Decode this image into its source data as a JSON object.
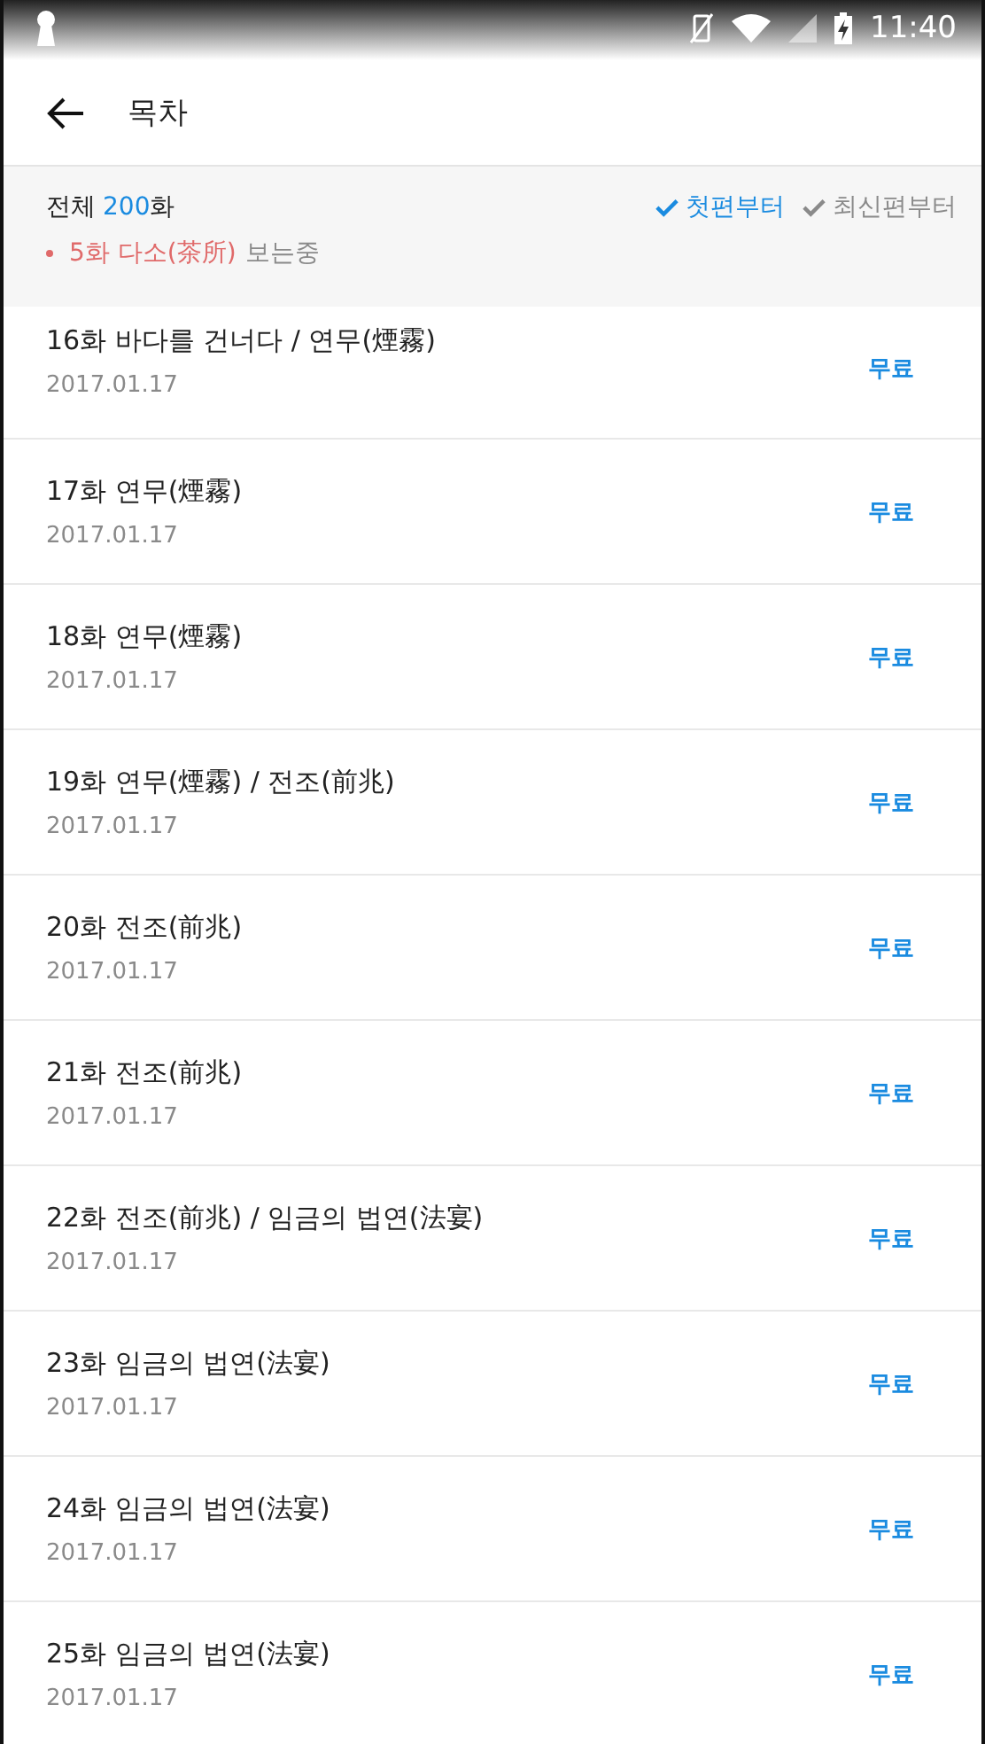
{
  "status_bar": {
    "time": "11:40"
  },
  "header": {
    "title": "목차"
  },
  "summary": {
    "total_prefix": "전체",
    "total_count": "200",
    "total_suffix": "화",
    "reading": "5화 다소(茶所)",
    "reading_suffix": "보는중",
    "sort_options": [
      {
        "label": "첫편부터",
        "selected": true
      },
      {
        "label": "최신편부터",
        "selected": false
      }
    ]
  },
  "episodes": [
    {
      "title": "16화 바다를 건너다 / 연무(煙霧)",
      "date": "2017.01.17",
      "price": "무료"
    },
    {
      "title": "17화 연무(煙霧)",
      "date": "2017.01.17",
      "price": "무료"
    },
    {
      "title": "18화 연무(煙霧)",
      "date": "2017.01.17",
      "price": "무료"
    },
    {
      "title": "19화 연무(煙霧) / 전조(前兆)",
      "date": "2017.01.17",
      "price": "무료"
    },
    {
      "title": "20화 전조(前兆)",
      "date": "2017.01.17",
      "price": "무료"
    },
    {
      "title": "21화 전조(前兆)",
      "date": "2017.01.17",
      "price": "무료"
    },
    {
      "title": "22화 전조(前兆) / 임금의 법연(法宴)",
      "date": "2017.01.17",
      "price": "무료"
    },
    {
      "title": "23화 임금의 법연(法宴)",
      "date": "2017.01.17",
      "price": "무료"
    },
    {
      "title": "24화 임금의 법연(法宴)",
      "date": "2017.01.17",
      "price": "무료"
    },
    {
      "title": "25화 임금의 법연(法宴)",
      "date": "2017.01.17",
      "price": "무료"
    }
  ]
}
